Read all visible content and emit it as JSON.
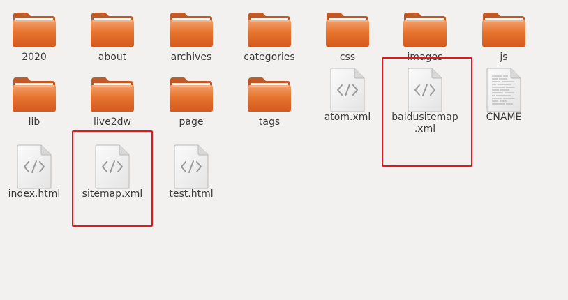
{
  "items": {
    "f2020": {
      "label": "2020"
    },
    "fabout": {
      "label": "about"
    },
    "farchives": {
      "label": "archives"
    },
    "fcategories": {
      "label": "categories"
    },
    "fcss": {
      "label": "css"
    },
    "fimages": {
      "label": "images"
    },
    "fjs": {
      "label": "js"
    },
    "flib": {
      "label": "lib"
    },
    "flive2dw": {
      "label": "live2dw"
    },
    "fpage": {
      "label": "page"
    },
    "ftags": {
      "label": "tags"
    },
    "atom": {
      "label": "atom.xml"
    },
    "baidu": {
      "label": "baidusitemap\n.xml"
    },
    "cname": {
      "label": "CNAME"
    },
    "index": {
      "label": "index.html"
    },
    "sitemap": {
      "label": "sitemap.xml"
    },
    "test": {
      "label": "test.html"
    }
  },
  "icons": {
    "folder": "folder-icon",
    "code_file": "code-file-icon",
    "text_file": "text-file-icon"
  },
  "colors": {
    "background": "#f2f1f0",
    "folder_orange": "#e0682a",
    "highlight_red": "#e8151b"
  }
}
